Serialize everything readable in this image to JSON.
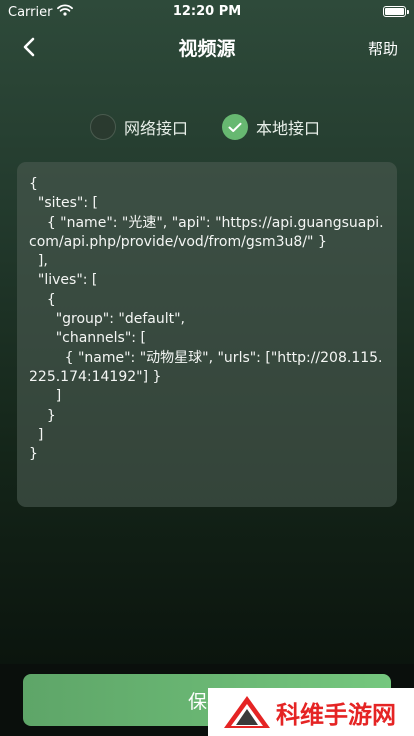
{
  "status_bar": {
    "carrier": "Carrier",
    "time": "12:20 PM"
  },
  "nav": {
    "title": "视频源",
    "help": "帮助"
  },
  "source_type": {
    "options": [
      {
        "label": "网络接口",
        "selected": false
      },
      {
        "label": "本地接口",
        "selected": true
      }
    ]
  },
  "editor": {
    "content": "{\n  \"sites\": [\n    { \"name\": \"光速\", \"api\": \"https://api.guangsuapi.com/api.php/provide/vod/from/gsm3u8/\" }\n  ],\n  \"lives\": [\n    {\n      \"group\": \"default\",\n      \"channels\": [\n        { \"name\": \"动物星球\", \"urls\": [\"http://208.115.225.174:14192\"] }\n      ]\n    }\n  ]\n}"
  },
  "footer": {
    "save_label": "保存"
  },
  "watermark": {
    "text": "科维手游网"
  },
  "colors": {
    "accent": "#67b871",
    "watermark_red": "#e52424"
  },
  "icons": {
    "back": "chevron-left-icon",
    "wifi": "wifi-icon",
    "battery": "battery-icon",
    "check": "check-icon"
  }
}
